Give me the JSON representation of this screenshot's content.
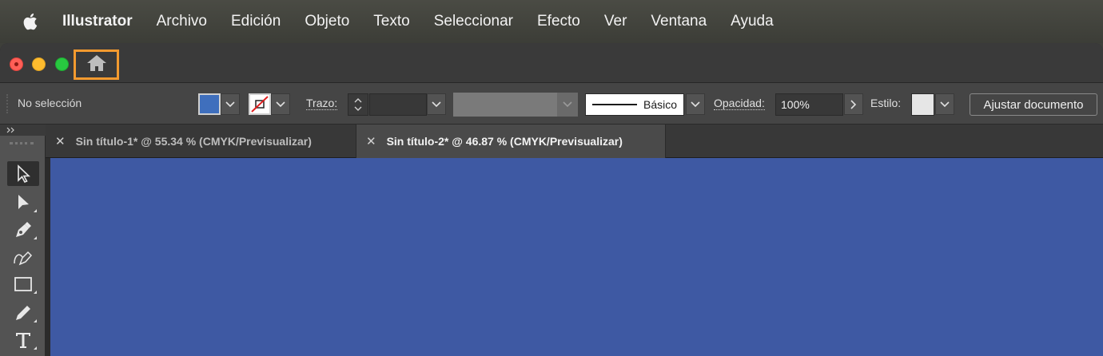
{
  "menubar": {
    "apple_icon": "apple-logo-icon",
    "items": [
      "Illustrator",
      "Archivo",
      "Edición",
      "Objeto",
      "Texto",
      "Seleccionar",
      "Efecto",
      "Ver",
      "Ventana",
      "Ayuda"
    ]
  },
  "titlebar": {
    "home_icon": "home-icon",
    "highlight_color": "#f39a2f"
  },
  "controlbar": {
    "selection_status": "No selección",
    "fill_color": "#3f6fbd",
    "stroke_color": "none",
    "stroke_label": "Trazo",
    "stroke_weight": "",
    "brush_label": "Básico",
    "opacity_label": "Opacidad",
    "opacity_value": "100%",
    "style_label": "Estilo",
    "adjust_button": "Ajustar documento"
  },
  "tabs": [
    {
      "label": "Sin título-1* @ 55.34 % (CMYK/Previsualizar)",
      "active": false
    },
    {
      "label": "Sin título-2* @ 46.87 % (CMYK/Previsualizar)",
      "active": true
    }
  ],
  "tools": [
    "selection-tool",
    "direct-selection-tool",
    "pen-tool",
    "curvature-tool",
    "rectangle-tool",
    "pencil-tool",
    "type-tool"
  ],
  "canvas": {
    "artboard_color": "#3e59a3"
  }
}
